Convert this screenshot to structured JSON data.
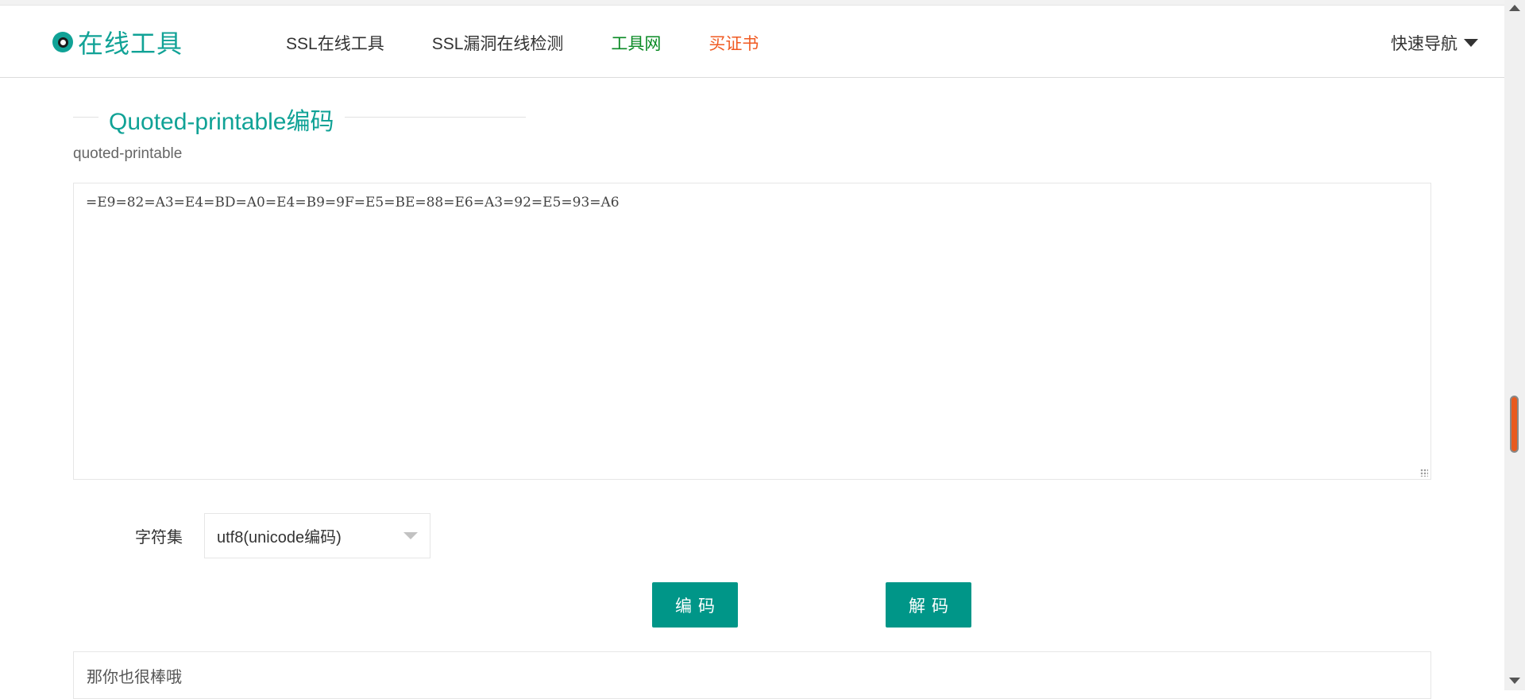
{
  "header": {
    "logo_text": "在线工具",
    "nav": [
      {
        "label": "SSL在线工具"
      },
      {
        "label": "SSL漏洞在线检测"
      },
      {
        "label": "工具网"
      },
      {
        "label": "买证书"
      }
    ],
    "quick_nav_label": "快速导航"
  },
  "main": {
    "title": "Quoted-printable编码",
    "subtitle": "quoted-printable",
    "input_value": "=E9=82=A3=E4=BD=A0=E4=B9=9F=E5=BE=88=E6=A3=92=E5=93=A6",
    "charset_label": "字符集",
    "charset_selected": "utf8(unicode编码)",
    "encode_label": "编码",
    "decode_label": "解码",
    "output_value": "那你也很棒哦"
  },
  "colors": {
    "accent": "#009688",
    "nav_green": "#0a8a24",
    "nav_orange": "#f05a22"
  }
}
